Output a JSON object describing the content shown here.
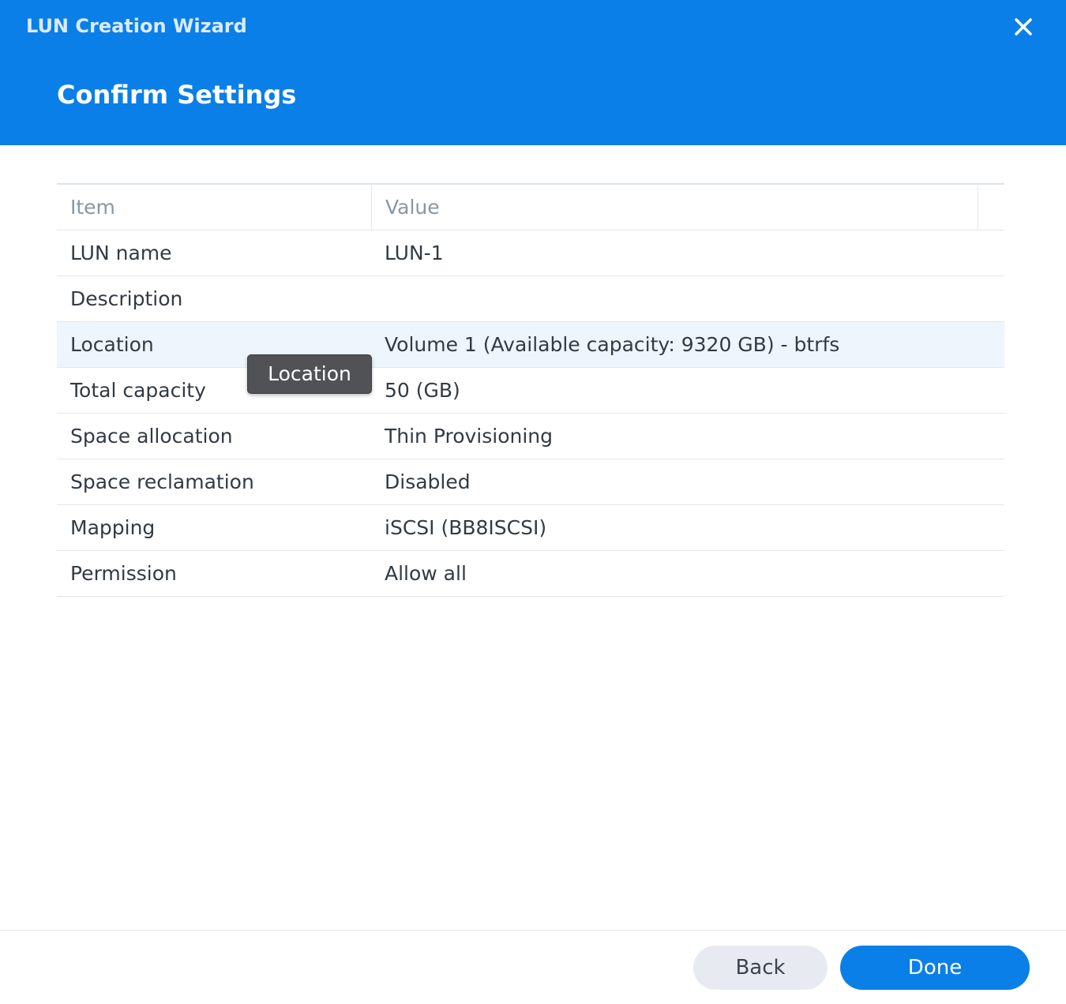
{
  "window": {
    "title": "LUN Creation Wizard",
    "close_icon": "close-icon",
    "accent_color": "#0a7fe8"
  },
  "step": {
    "title": "Confirm Settings"
  },
  "grid": {
    "columns": [
      "Item",
      "Value"
    ],
    "rows": [
      {
        "item": "LUN name",
        "value": "LUN-1"
      },
      {
        "item": "Description",
        "value": ""
      },
      {
        "item": "Location",
        "value": "Volume 1 (Available capacity: 9320 GB) - btrfs"
      },
      {
        "item": "Total capacity",
        "value": "50 (GB)"
      },
      {
        "item": "Space allocation",
        "value": "Thin Provisioning"
      },
      {
        "item": "Space reclamation",
        "value": "Disabled"
      },
      {
        "item": "Mapping",
        "value": "iSCSI (BB8ISCSI)"
      },
      {
        "item": "Permission",
        "value": "Allow all"
      }
    ],
    "hovered_row": "Location"
  },
  "tooltip": {
    "text": "Location"
  },
  "footer": {
    "back_label": "Back",
    "done_label": "Done"
  }
}
